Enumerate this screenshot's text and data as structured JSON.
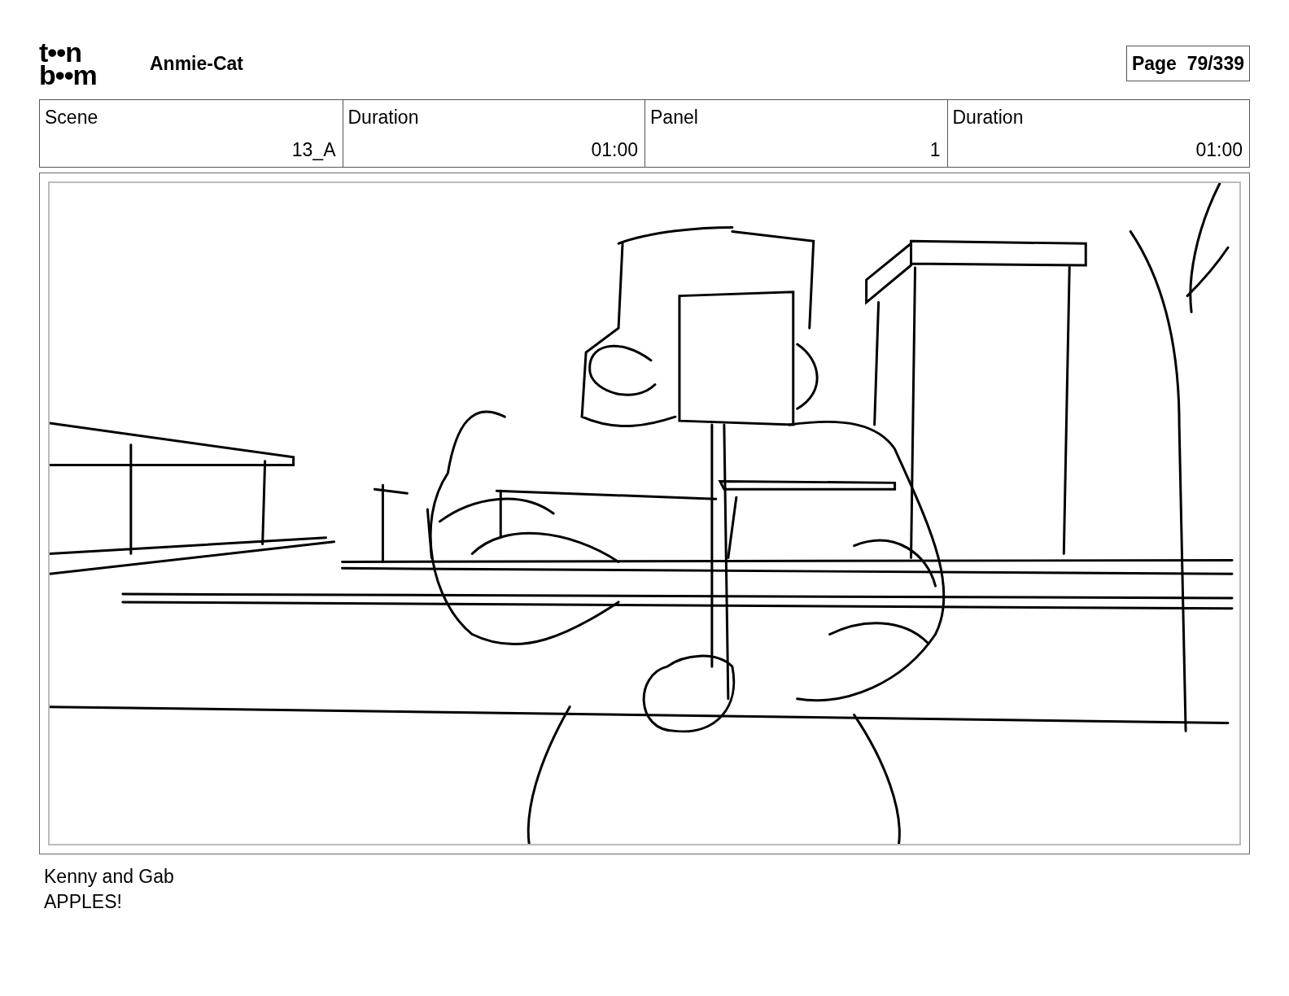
{
  "logo": {
    "line1": "t••n",
    "line2": "b••m"
  },
  "project": "Anmie-Cat",
  "page": "Page  79/339",
  "table": {
    "columns": [
      "Scene",
      "Duration",
      "Panel",
      "Duration"
    ],
    "row": [
      "13_A",
      "01:00",
      "1",
      "01:00"
    ]
  },
  "caption": [
    "Kenny and Gab",
    "APPLES!"
  ]
}
